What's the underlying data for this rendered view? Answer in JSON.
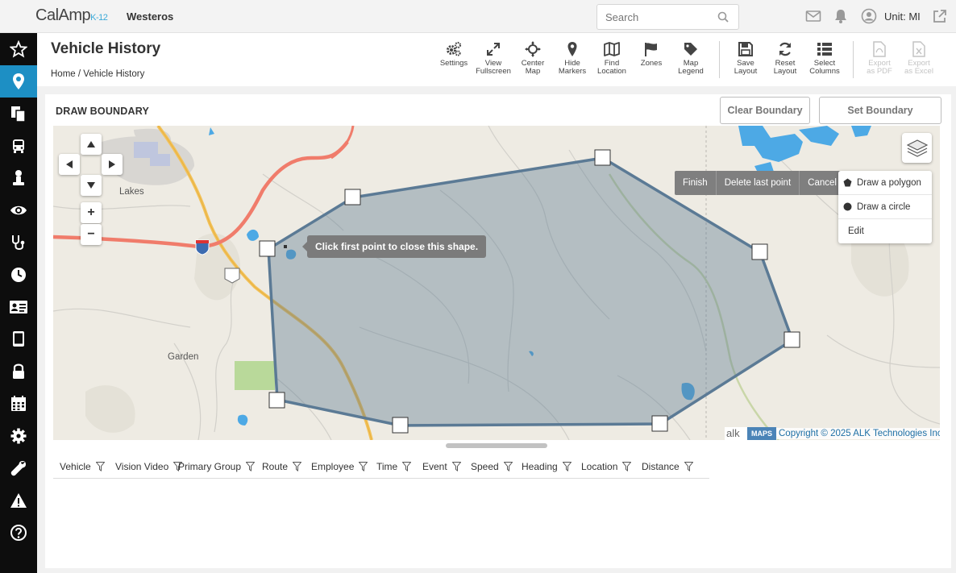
{
  "header": {
    "logo_brand": "CalAmp",
    "logo_suffix": "K-12",
    "org_name": "Westeros",
    "search_placeholder": "Search",
    "unit_label": "Unit: MI"
  },
  "sidebar": {
    "items": [
      {
        "icon": "star-icon",
        "active": false
      },
      {
        "icon": "map-pin-icon",
        "active": true
      },
      {
        "icon": "documents-icon",
        "active": false
      },
      {
        "icon": "bus-icon",
        "active": false
      },
      {
        "icon": "driver-icon",
        "active": false
      },
      {
        "icon": "eye-icon",
        "active": false
      },
      {
        "icon": "stethoscope-icon",
        "active": false
      },
      {
        "icon": "clock-icon",
        "active": false
      },
      {
        "icon": "id-card-icon",
        "active": false
      },
      {
        "icon": "tablet-icon",
        "active": false
      },
      {
        "icon": "lock-icon",
        "active": false
      },
      {
        "icon": "calendar-icon",
        "active": false
      },
      {
        "icon": "gear-icon",
        "active": false
      },
      {
        "icon": "wrench-icon",
        "active": false
      },
      {
        "icon": "warning-icon",
        "active": false
      },
      {
        "icon": "help-icon",
        "active": false
      }
    ]
  },
  "page": {
    "title": "Vehicle History",
    "breadcrumb_home": "Home",
    "breadcrumb_sep": "/",
    "breadcrumb_current": "Vehicle History"
  },
  "toolbar": {
    "settings": "Settings",
    "view_fullscreen_1": "View",
    "view_fullscreen_2": "Fullscreen",
    "center_map_1": "Center",
    "center_map_2": "Map",
    "hide_markers_1": "Hide",
    "hide_markers_2": "Markers",
    "find_location_1": "Find",
    "find_location_2": "Location",
    "zones": "Zones",
    "map_legend_1": "Map",
    "map_legend_2": "Legend",
    "save_layout_1": "Save",
    "save_layout_2": "Layout",
    "reset_layout_1": "Reset",
    "reset_layout_2": "Layout",
    "select_columns_1": "Select",
    "select_columns_2": "Columns",
    "export_pdf_1": "Export",
    "export_pdf_2": "as PDF",
    "export_excel_1": "Export",
    "export_excel_2": "as Excel"
  },
  "draw": {
    "title": "DRAW BOUNDARY",
    "clear_button": "Clear Boundary",
    "set_button": "Set Boundary",
    "finish": "Finish",
    "delete_last": "Delete last point",
    "cancel": "Cancel",
    "menu_polygon": "Draw a polygon",
    "menu_circle": "Draw a circle",
    "menu_edit": "Edit",
    "tooltip": "Click first point to close this shape."
  },
  "map": {
    "places": [
      "Lakes",
      "Garden"
    ],
    "attribution_alk": "alk",
    "attribution_maps": "MAPS",
    "copyright": "Copyright © 2025 ALK Technologies Inc.",
    "zoom_in": "+",
    "zoom_out": "−",
    "colors": {
      "polygon_fill": "#5d7a90",
      "polygon_stroke": "#5b7a95",
      "water": "#4da9e5",
      "highway": "#f07c6b",
      "major_road": "#f2c25a",
      "park": "#b9d99a"
    }
  },
  "table": {
    "columns": [
      "Vehicle",
      "Vision Video",
      "Primary Group",
      "Route",
      "Employee",
      "Time",
      "Event",
      "Speed",
      "Heading",
      "Location",
      "Distance"
    ]
  }
}
